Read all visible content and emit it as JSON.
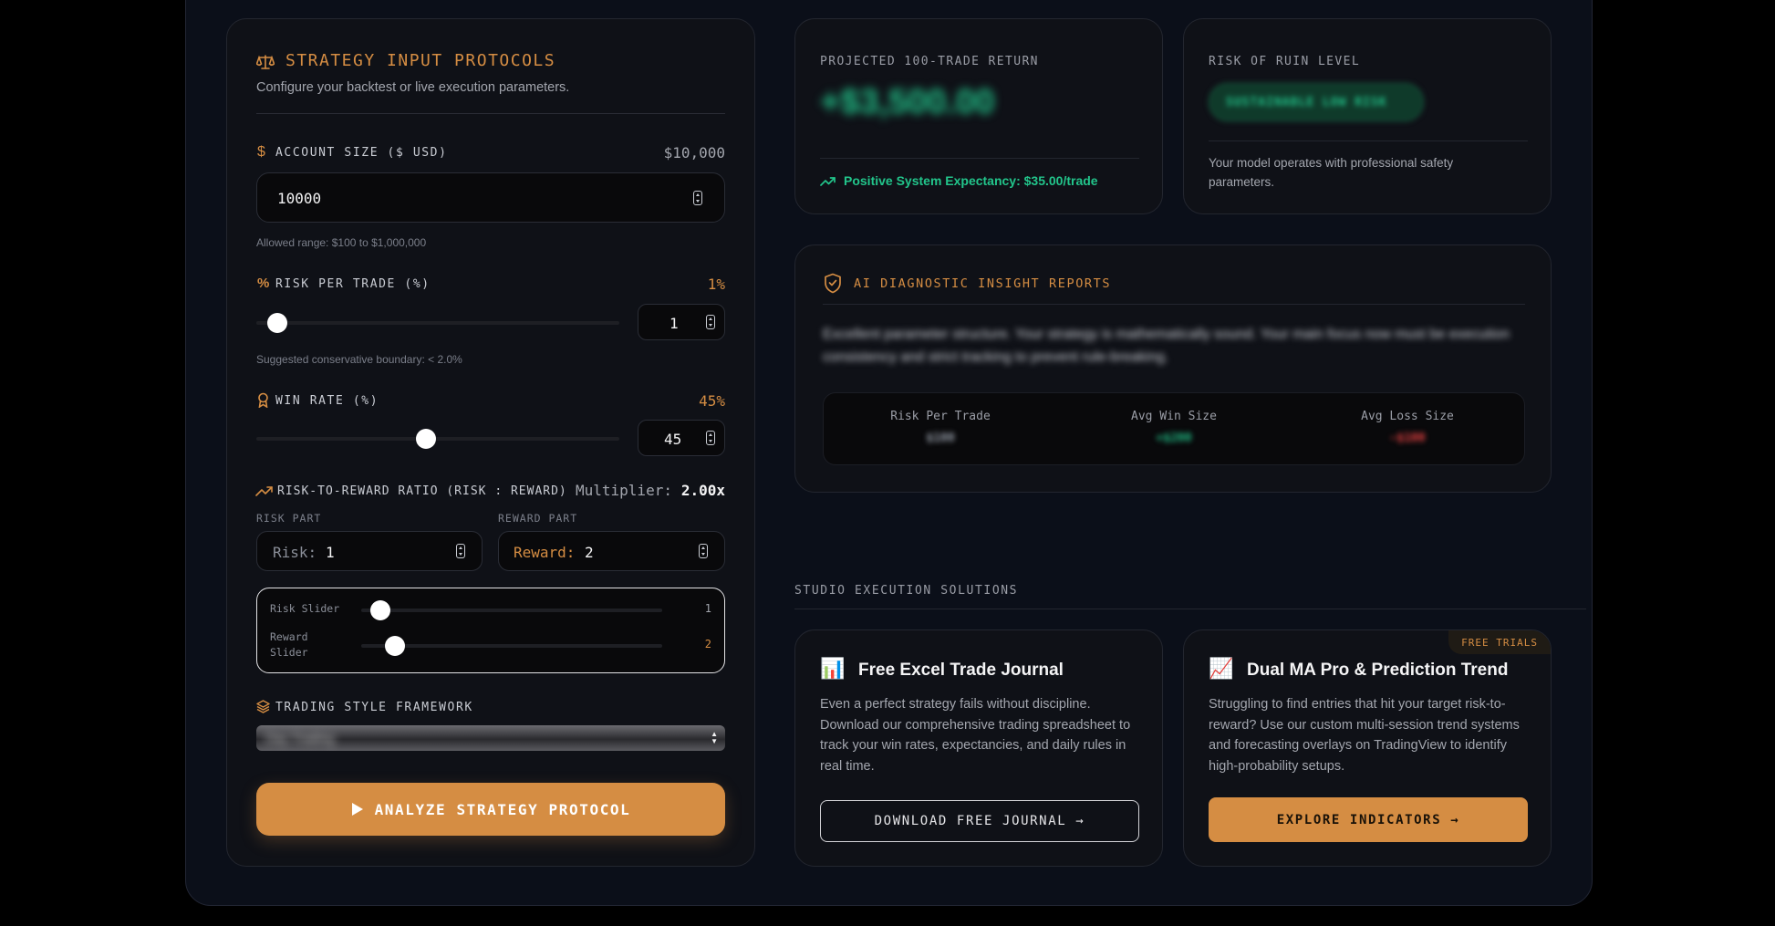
{
  "inputs": {
    "title": "STRATEGY INPUT PROTOCOLS",
    "subtitle": "Configure your backtest or live execution parameters.",
    "account": {
      "label": "ACCOUNT SIZE ($ USD)",
      "display": "$10,000",
      "value": "10000",
      "hint": "Allowed range: $100 to $1,000,000"
    },
    "risk": {
      "label": "RISK PER TRADE (%)",
      "display": "1%",
      "value": "1",
      "slider_fraction": 0.03,
      "hint": "Suggested conservative boundary: < 2.0%"
    },
    "winrate": {
      "label": "WIN RATE (%)",
      "display": "45%",
      "value": "45",
      "slider_fraction": 0.44
    },
    "rr": {
      "label": "RISK-TO-REWARD RATIO (RISK : REWARD)",
      "multiplier_label": "Multiplier:",
      "multiplier_value": "2.00x",
      "risk_part_label": "RISK PART",
      "reward_part_label": "REWARD PART",
      "risk_prefix": "Risk:",
      "risk_value": "1",
      "reward_prefix": "Reward:",
      "reward_value": "2",
      "risk_slider_label": "Risk Slider",
      "risk_slider_value": "1",
      "reward_slider_label": "Reward Slider",
      "reward_slider_value": "2",
      "risk_slider_fraction": 0.03,
      "reward_slider_fraction": 0.08
    },
    "style": {
      "label": "TRADING STYLE FRAMEWORK",
      "selected": "Day Trading"
    },
    "analyze_label": "ANALYZE STRATEGY PROTOCOL"
  },
  "projection": {
    "label": "PROJECTED 100-TRADE RETURN",
    "value": "+$3,500.00",
    "expectancy": "Positive System Expectancy: $35.00/trade"
  },
  "ruin": {
    "label": "RISK OF RUIN LEVEL",
    "badge": "SUSTAINABLE LOW RISK",
    "note": "Your model operates with professional safety parameters."
  },
  "diagnostic": {
    "title": "AI DIAGNOSTIC INSIGHT REPORTS",
    "text": "Excellent parameter structure. Your strategy is mathematically sound. Your main focus now must be execution consistency and strict tracking to prevent rule-breaking.",
    "metrics": [
      {
        "label": "Risk Per Trade",
        "value": "$100",
        "color": "#9ca3af"
      },
      {
        "label": "Avg Win Size",
        "value": "+$200",
        "color": "#22c58b"
      },
      {
        "label": "Avg Loss Size",
        "value": "-$100",
        "color": "#ef4444"
      }
    ]
  },
  "solutions": {
    "heading": "STUDIO EXECUTION SOLUTIONS",
    "excel": {
      "icon": "📊",
      "title": "Free Excel Trade Journal",
      "body": "Even a perfect strategy fails without discipline. Download our comprehensive trading spreadsheet to track your win rates, expectancies, and daily rules in real time.",
      "button": "DOWNLOAD FREE JOURNAL →"
    },
    "dual": {
      "badge": "FREE TRIALS",
      "icon": "📈",
      "title": "Dual MA Pro & Prediction Trend",
      "body": "Struggling to find entries that hit your target risk-to-reward? Use our custom multi-session trend systems and forecasting overlays on TradingView to identify high-probability setups.",
      "button": "EXPLORE INDICATORS →"
    }
  },
  "colors": {
    "accent": "#d58d43",
    "positive": "#22c58b",
    "negative": "#ef4444"
  }
}
